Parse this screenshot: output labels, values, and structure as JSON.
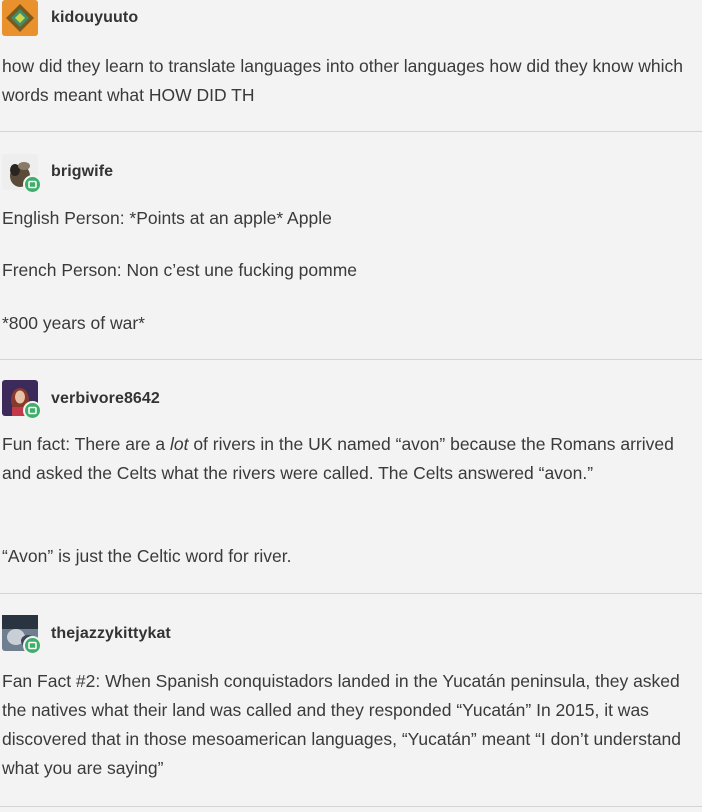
{
  "posts": [
    {
      "username": "kidouyuuto",
      "avatar": "diamond-avatar-icon",
      "paragraphs": [
        "how did they learn to translate languages into other languages how did they know which words meant what HOW DID TH"
      ]
    },
    {
      "username": "brigwife",
      "avatar": "brigwife-avatar-icon",
      "paragraphs": [
        "English Person: *Points at an apple* Apple",
        "French Person: Non c’est une fucking pomme",
        "*800 years of war*"
      ]
    },
    {
      "username": "verbivore8642",
      "avatar": "verbivore-avatar-icon",
      "paragraphs": [
        "Fun fact: There are a lot of rivers in the UK named “avon” because the Romans arrived and asked the Celts what the rivers were called. The Celts answered “avon.”",
        "“Avon” is just the Celtic word for river."
      ]
    },
    {
      "username": "thejazzykittykat",
      "avatar": "jazzykittykat-avatar-icon",
      "paragraphs": [
        "Fan Fact #2: When Spanish conquistadors landed in the Yucatán peninsula, they asked the natives what their land was called and they responded “Yucatán” In 2015, it was discovered that in those mesoamerican languages, “Yucatán” meant “I don’t understand what you are saying”"
      ]
    }
  ],
  "colors": {
    "background": "#f3f3f3",
    "text": "#3a3a3a",
    "divider": "#d4d4d4",
    "reblog_badge": "#3fae6a",
    "avatar_orange": "#e8912d"
  }
}
